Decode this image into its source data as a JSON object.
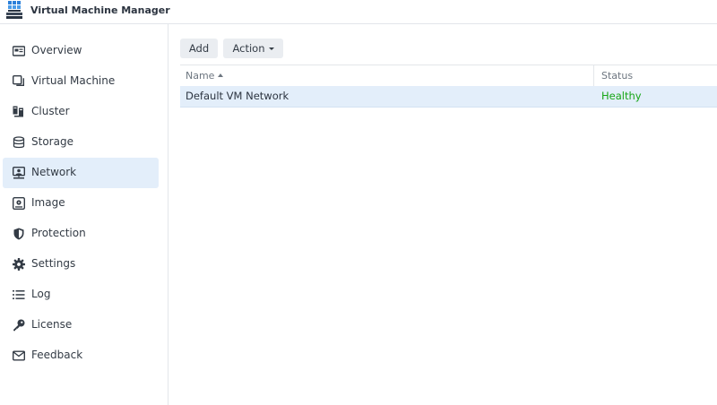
{
  "app": {
    "title": "Virtual Machine Manager"
  },
  "sidebar": {
    "items": [
      {
        "label": "Overview",
        "icon": "overview-icon",
        "active": false
      },
      {
        "label": "Virtual Machine",
        "icon": "virtual-machine-icon",
        "active": false
      },
      {
        "label": "Cluster",
        "icon": "cluster-icon",
        "active": false
      },
      {
        "label": "Storage",
        "icon": "storage-icon",
        "active": false
      },
      {
        "label": "Network",
        "icon": "network-icon",
        "active": true
      },
      {
        "label": "Image",
        "icon": "image-icon",
        "active": false
      },
      {
        "label": "Protection",
        "icon": "shield-icon",
        "active": false
      },
      {
        "label": "Settings",
        "icon": "gear-icon",
        "active": false
      },
      {
        "label": "Log",
        "icon": "list-icon",
        "active": false
      },
      {
        "label": "License",
        "icon": "key-icon",
        "active": false
      },
      {
        "label": "Feedback",
        "icon": "mail-icon",
        "active": false
      }
    ]
  },
  "toolbar": {
    "add_label": "Add",
    "action_label": "Action"
  },
  "table": {
    "columns": [
      {
        "label": "Name",
        "sorted": "asc"
      },
      {
        "label": "Status"
      }
    ],
    "rows": [
      {
        "name": "Default VM Network",
        "status": "Healthy"
      }
    ]
  },
  "colors": {
    "accent": "#e3eefa",
    "status_healthy": "#18a617",
    "logo_blue": "#2b7fd9"
  }
}
